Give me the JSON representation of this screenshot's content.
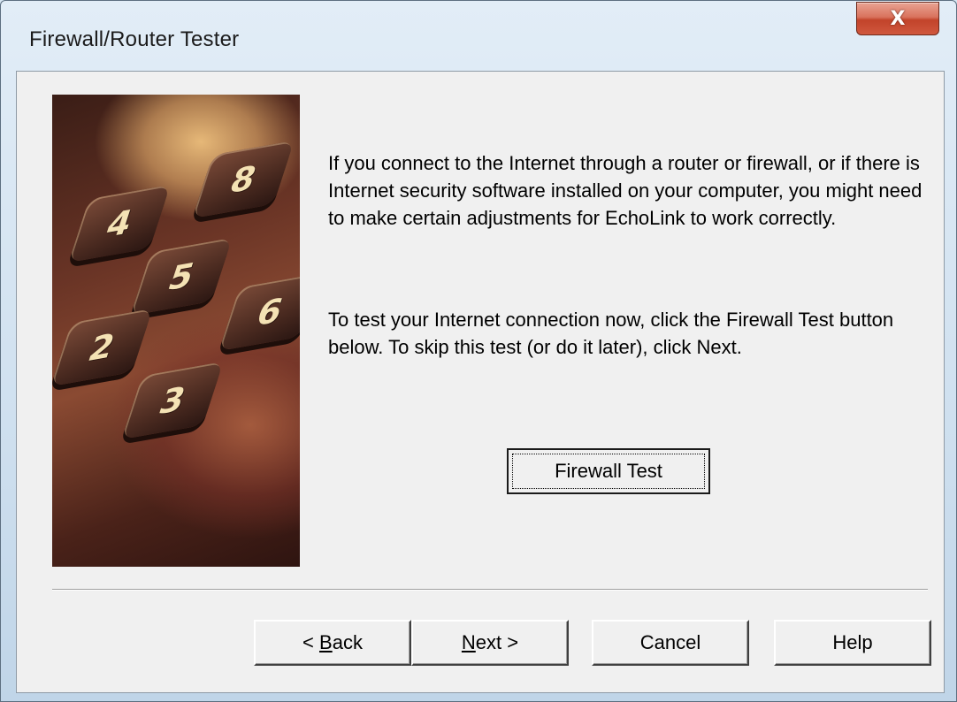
{
  "window": {
    "title": "Firewall/Router Tester",
    "close_glyph": "X"
  },
  "content": {
    "paragraph1": "If you connect to the Internet through a router or firewall, or if there is Internet security software installed on your computer, you might need to make certain adjustments for EchoLink to work correctly.",
    "paragraph2": "To test your Internet connection now, click the Firewall Test button below.  To skip this test (or do it later), click Next.",
    "firewall_test_label": "Firewall Test"
  },
  "image": {
    "keys": [
      "8",
      "4",
      "5",
      "6",
      "2",
      "3"
    ]
  },
  "buttons": {
    "back": {
      "accel": "B",
      "prefix": "< ",
      "rest": "ack"
    },
    "next": {
      "accel": "N",
      "rest": "ext >"
    },
    "cancel": "Cancel",
    "help": "Help"
  },
  "colors": {
    "dialog_bg": "#f0f0f0",
    "close_button": "#c2432a",
    "title_bar": "#cfe0ef"
  }
}
